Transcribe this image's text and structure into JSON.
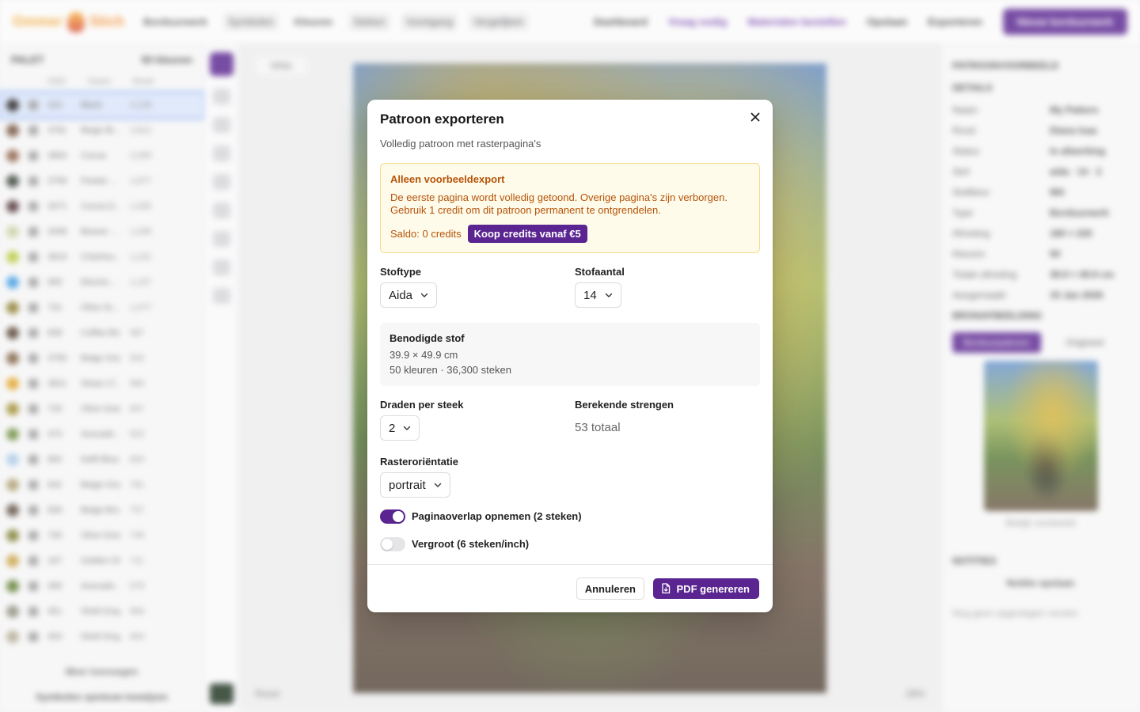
{
  "background": {
    "logo": {
      "part1": "Gmmer",
      "part2": "Stich"
    },
    "topnav": [
      "Borduurwerk",
      "Symbolen",
      "Kleuren",
      "Steken",
      "Voortgang",
      "Vergelijken"
    ],
    "topbar_right": [
      "Dashboard",
      "Vraag nodig",
      "Materialen bestellen",
      "Opslaan",
      "Exporteren"
    ],
    "topbar_primary": "Nieuw borduurwerk",
    "left_panel": {
      "title": "PALET",
      "count": "50 kleuren",
      "columns": [
        "DMC",
        "Naam",
        "Steek"
      ],
      "rows": [
        {
          "color": "#1e1e1e",
          "code": "310",
          "name": "Black",
          "count": "4,128"
        },
        {
          "color": "#6e4a35",
          "code": "3781",
          "name": "Beige Br...",
          "count": "2,812"
        },
        {
          "color": "#8a5a3f",
          "code": "3863",
          "name": "Cocoa",
          "count": "2,055"
        },
        {
          "color": "#2f3a2e",
          "code": "3799",
          "name": "Pewter ...",
          "count": "1,877"
        },
        {
          "color": "#4a2b30",
          "code": "3371",
          "name": "Cocoa D...",
          "count": "1,630"
        },
        {
          "color": "#c9cfa0",
          "code": "3348",
          "name": "Beaver ...",
          "count": "1,346"
        },
        {
          "color": "#b6c83a",
          "code": "3819",
          "name": "Chartreu...",
          "count": "1,231"
        },
        {
          "color": "#3a9ae0",
          "code": "995",
          "name": "Electric...",
          "count": "1,157"
        },
        {
          "color": "#8a7a2a",
          "code": "731",
          "name": "Olive Gr...",
          "count": "1,077"
        },
        {
          "color": "#4e3a2a",
          "code": "838",
          "name": "Coffee Bro...",
          "count": "987"
        },
        {
          "color": "#7a5a3a",
          "code": "3790",
          "name": "Beige Gra...",
          "count": "934"
        },
        {
          "color": "#e0a020",
          "code": "3821",
          "name": "Straw LT...",
          "count": "866"
        },
        {
          "color": "#9a8a2a",
          "code": "733",
          "name": "Olive Gree...",
          "count": "847"
        },
        {
          "color": "#6a8a3a",
          "code": "470",
          "name": "Avocado ...",
          "count": "823"
        },
        {
          "color": "#a8c8e8",
          "code": "800",
          "name": "Delft Blue...",
          "count": "804"
        },
        {
          "color": "#a89a6a",
          "code": "642",
          "name": "Beige Gra...",
          "count": "781"
        },
        {
          "color": "#5a4a3a",
          "code": "839",
          "name": "Beige Bro...",
          "count": "757"
        },
        {
          "color": "#7a7a2a",
          "code": "730",
          "name": "Olive Gree...",
          "count": "749"
        },
        {
          "color": "#c8a040",
          "code": "167",
          "name": "Golden Ol...",
          "count": "711"
        },
        {
          "color": "#5a7a2a",
          "code": "469",
          "name": "Avocado ...",
          "count": "678"
        },
        {
          "color": "#8a8a7a",
          "code": "451",
          "name": "Shell Gray...",
          "count": "666"
        },
        {
          "color": "#b0a890",
          "code": "453",
          "name": "Shell Gray...",
          "count": "604"
        }
      ],
      "more": "Meer toevoegen",
      "footer": "Symbolen opnieuw toewijzen"
    },
    "canvas": {
      "label": "Witte",
      "zoom": "28%",
      "footer_left": "Reset"
    },
    "right_panel": {
      "section1": "PATROONVOORBEELD",
      "section2": "DETAILS",
      "details": [
        {
          "k": "Naam",
          "v": "My Pattern"
        },
        {
          "k": "Rood",
          "v": "Diana Isaa"
        },
        {
          "k": "Status",
          "v": "In afwerking"
        },
        {
          "k": "Stof",
          "v": "aida · 14 · 2"
        },
        {
          "k": "Stofkleur",
          "v": "Wit"
        }
      ],
      "details2": [
        {
          "k": "Type",
          "v": "Borduurwerk"
        },
        {
          "k": "Afmeting",
          "v": "180 × 220"
        },
        {
          "k": "Kleuren",
          "v": "50"
        },
        {
          "k": "Totale afmeting",
          "v": "39.9 × 49.9 cm"
        },
        {
          "k": "Aangemaakt",
          "v": "15 Jan 2026"
        }
      ],
      "section3": "BRONAFBEELDING",
      "toggle": [
        "Borduurpatroon",
        "Origineel"
      ],
      "thumb_caption": "Bekijk voorbeeld",
      "section4": "NOTITIES",
      "add_note": "Notitie opslaan",
      "note_hint": "Nog geen opgeslagen versies"
    }
  },
  "modal": {
    "title": "Patroon exporteren",
    "subtitle": "Volledig patroon met rasterpagina's",
    "alert": {
      "title": "Alleen voorbeeldexport",
      "body": "De eerste pagina wordt volledig getoond. Overige pagina's zijn verborgen.\nGebruik 1 credit om dit patroon permanent te ontgrendelen.",
      "balance": "Saldo: 0 credits",
      "buy_label": "Koop credits vanaf €5"
    },
    "fabric_type": {
      "label": "Stoftype",
      "value": "Aida"
    },
    "fabric_count": {
      "label": "Stofaantal",
      "value": "14"
    },
    "fabric_needed": {
      "title": "Benodigde stof",
      "size": "39.9 × 49.9 cm",
      "summary": "50 kleuren · 36,300 steken"
    },
    "threads": {
      "label": "Draden per steek",
      "value": "2"
    },
    "strands": {
      "label": "Berekende strengen",
      "value": "53 totaal"
    },
    "orientation": {
      "label": "Rasteroriëntatie",
      "value": "portrait"
    },
    "overlap": {
      "label": "Paginaoverlap opnemen (2 steken)",
      "on": true
    },
    "enlarge": {
      "label": "Vergroot (6 steken/inch)",
      "on": false
    },
    "cancel_label": "Annuleren",
    "generate_label": "PDF genereren"
  }
}
